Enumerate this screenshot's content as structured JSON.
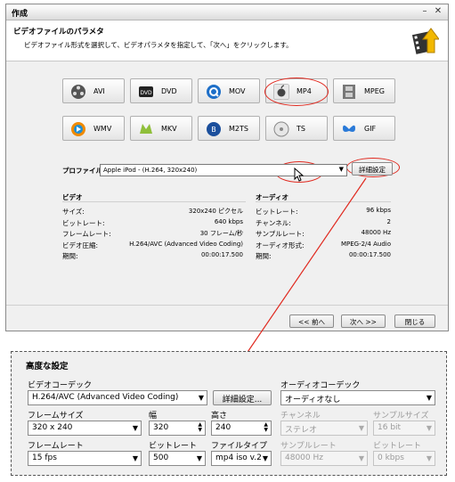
{
  "window": {
    "title": "作成"
  },
  "header": {
    "heading": "ビデオファイルのパラメタ",
    "instruction": "ビデオファイル形式を選択して、ビデオパラメタを指定して、「次へ」をクリックします。"
  },
  "formats": [
    {
      "label": "AVI",
      "icon": "film-reel-icon"
    },
    {
      "label": "DVD",
      "icon": "dvd-icon"
    },
    {
      "label": "MOV",
      "icon": "quicktime-icon"
    },
    {
      "label": "MP4",
      "icon": "apple-icon"
    },
    {
      "label": "MPEG",
      "icon": "film-strip-icon"
    },
    {
      "label": "WMV",
      "icon": "windows-media-icon"
    },
    {
      "label": "MKV",
      "icon": "mkv-icon"
    },
    {
      "label": "M2TS",
      "icon": "bluray-icon"
    },
    {
      "label": "TS",
      "icon": "disc-icon"
    },
    {
      "label": "GIF",
      "icon": "butterfly-icon"
    }
  ],
  "profile": {
    "label": "プロファイル",
    "value": "Apple iPod - (H.264, 320x240)",
    "details_button": "詳細設定"
  },
  "video": {
    "heading": "ビデオ",
    "rows": [
      {
        "label": "サイズ:",
        "value": "320x240 ピクセル"
      },
      {
        "label": "ビットレート:",
        "value": "640 kbps"
      },
      {
        "label": "フレームレート:",
        "value": "30 フレーム/秒"
      },
      {
        "label": "ビデオ圧縮:",
        "value": "H.264/AVC (Advanced Video Coding)"
      },
      {
        "label": "期間:",
        "value": "00:00:17.500"
      }
    ]
  },
  "audio": {
    "heading": "オーディオ",
    "rows": [
      {
        "label": "ビットレート:",
        "value": "96 kbps"
      },
      {
        "label": "チャンネル:",
        "value": "2"
      },
      {
        "label": "サンプルレート:",
        "value": "48000 Hz"
      },
      {
        "label": "オーディオ形式:",
        "value": "MPEG-2/4 Audio"
      },
      {
        "label": "期間:",
        "value": "00:00:17.500"
      }
    ]
  },
  "nav": {
    "back": "<< 前へ",
    "next": "次へ >>",
    "close": "閉じる"
  },
  "advanced": {
    "title": "高度な設定",
    "video_codec": {
      "label": "ビデオコーデック",
      "value": "H.264/AVC (Advanced Video Coding)",
      "details_button": "詳細設定..."
    },
    "audio_codec": {
      "label": "オーディオコーデック",
      "value": "オーディオなし"
    },
    "frame_size": {
      "label": "フレームサイズ",
      "value": "320 x 240"
    },
    "width": {
      "label": "幅",
      "value": "320"
    },
    "height": {
      "label": "高さ",
      "value": "240"
    },
    "channels": {
      "label": "チャンネル",
      "value": "ステレオ"
    },
    "sample_size": {
      "label": "サンプルサイズ",
      "value": "16 bit"
    },
    "frame_rate": {
      "label": "フレームレート",
      "value": "15 fps"
    },
    "video_bitrate": {
      "label": "ビットレート",
      "value": "500"
    },
    "file_type": {
      "label": "ファイルタイプ",
      "value": "mp4 iso v.2"
    },
    "sample_rate": {
      "label": "サンプルレート",
      "value": "48000 Hz"
    },
    "audio_bitrate": {
      "label": "ビットレート",
      "value": "0 kbps"
    }
  },
  "colors": {
    "highlight": "#e0281e",
    "dialog_bg": "#f0f0f0"
  }
}
